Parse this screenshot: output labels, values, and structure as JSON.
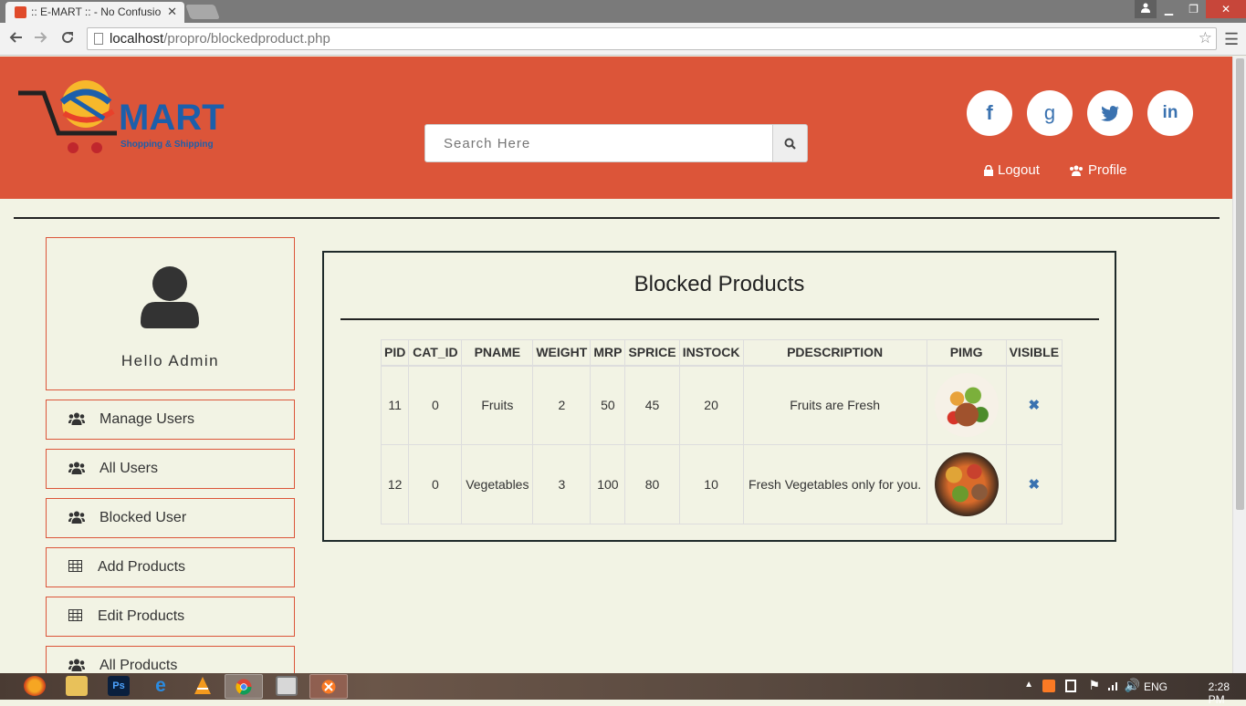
{
  "browser": {
    "tab_title": ":: E-MART :: - No Confusio",
    "url_host": "localhost",
    "url_path": "/propro/blockedproduct.php"
  },
  "header": {
    "logo_text": "MART",
    "logo_tagline": "Shopping & Shipping",
    "search_placeholder": "Search Here",
    "social": [
      "f",
      "g",
      "t",
      "in"
    ],
    "logout_label": "Logout",
    "profile_label": "Profile",
    "accent_color": "#dc5539"
  },
  "sidebar": {
    "greeting": "Hello Admin",
    "items": [
      {
        "label": "Manage Users",
        "icon": "users-icon"
      },
      {
        "label": "All Users",
        "icon": "users-icon"
      },
      {
        "label": "Blocked User",
        "icon": "users-icon"
      },
      {
        "label": "Add Products",
        "icon": "table-icon"
      },
      {
        "label": "Edit Products",
        "icon": "table-icon"
      },
      {
        "label": "All Products",
        "icon": "users-icon"
      }
    ]
  },
  "main": {
    "title": "Blocked Products",
    "columns": [
      "PID",
      "CAT_ID",
      "PNAME",
      "WEIGHT",
      "MRP",
      "SPRICE",
      "INSTOCK",
      "PDESCRIPTION",
      "PIMG",
      "VISIBLE"
    ],
    "rows": [
      {
        "pid": "11",
        "cat_id": "0",
        "pname": "Fruits",
        "weight": "2",
        "mrp": "50",
        "sprice": "45",
        "instock": "20",
        "pdescription": "Fruits are Fresh",
        "visible": "✖"
      },
      {
        "pid": "12",
        "cat_id": "0",
        "pname": "Vegetables",
        "weight": "3",
        "mrp": "100",
        "sprice": "80",
        "instock": "10",
        "pdescription": "Fresh Vegetables only for you.",
        "visible": "✖"
      }
    ]
  },
  "taskbar": {
    "language": "ENG",
    "time": "2:28 PM"
  }
}
